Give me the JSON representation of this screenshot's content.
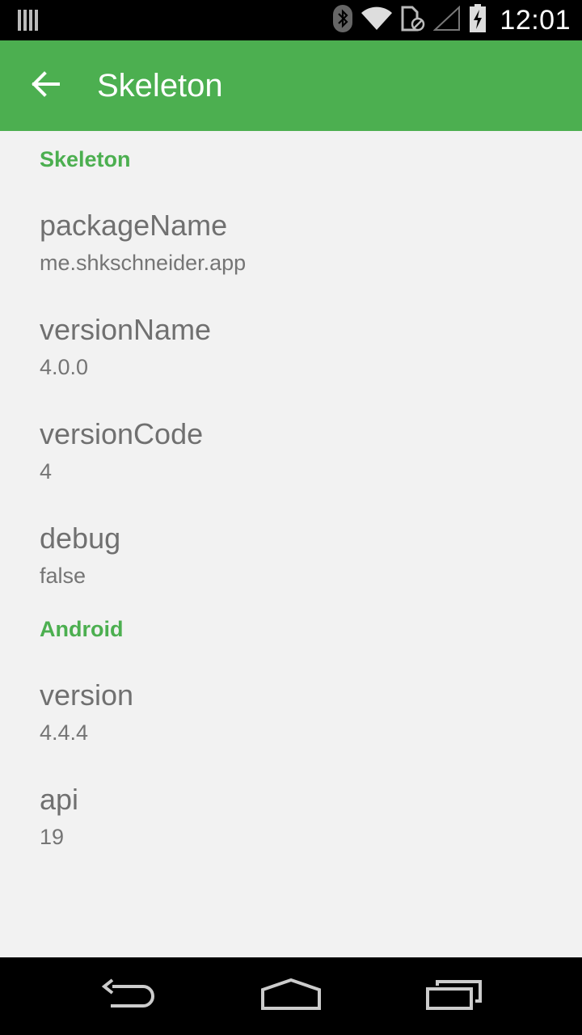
{
  "status_bar": {
    "time": "12:01",
    "icons": [
      "notification-icon",
      "bluetooth-icon",
      "wifi-icon",
      "sim-card-icon",
      "cell-signal-icon",
      "battery-charging-icon"
    ]
  },
  "toolbar": {
    "title": "Skeleton",
    "back_icon": "arrow-back-icon",
    "background_color": "#4caf50"
  },
  "sections": [
    {
      "header": "Skeleton",
      "items": [
        {
          "title": "packageName",
          "summary": "me.shkschneider.app"
        },
        {
          "title": "versionName",
          "summary": "4.0.0"
        },
        {
          "title": "versionCode",
          "summary": "4"
        },
        {
          "title": "debug",
          "summary": "false"
        }
      ]
    },
    {
      "header": "Android",
      "items": [
        {
          "title": "version",
          "summary": "4.4.4"
        },
        {
          "title": "api",
          "summary": "19"
        }
      ]
    }
  ],
  "nav_bar": {
    "icons": [
      "back-icon",
      "home-icon",
      "recents-icon"
    ]
  }
}
